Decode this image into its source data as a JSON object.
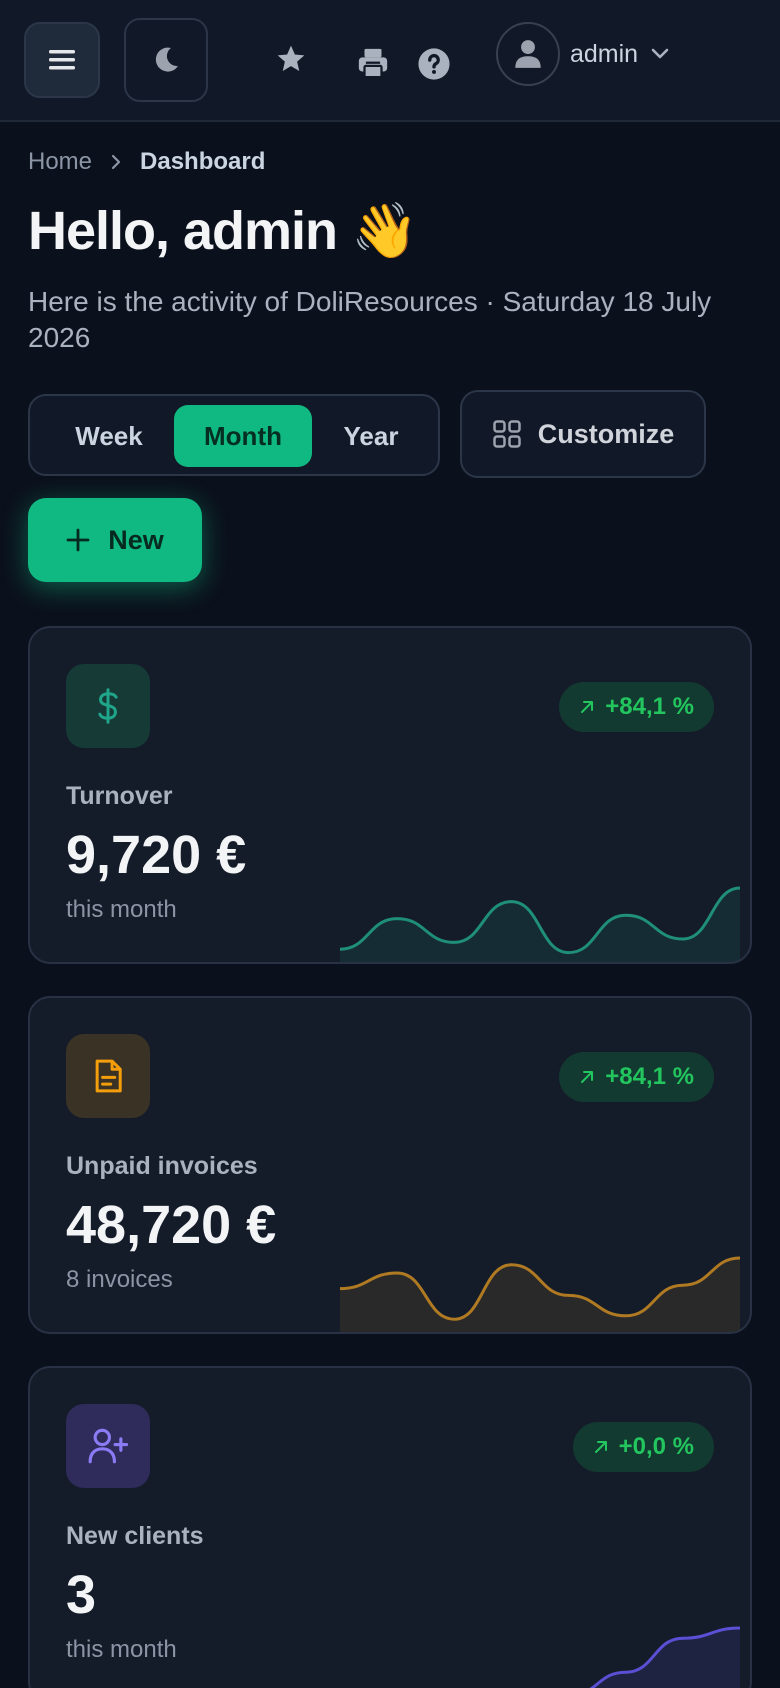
{
  "topbar": {
    "user_name": "admin",
    "icons": [
      "menu-icon",
      "moon-icon",
      "star-icon",
      "printer-icon",
      "help-icon",
      "user-icon",
      "chevron-down-icon"
    ]
  },
  "breadcrumb": {
    "home": "Home",
    "current": "Dashboard"
  },
  "header": {
    "title": "Hello, admin",
    "emoji": "👋",
    "subtitle": "Here is the activity of DoliResources · Saturday 18 July 2026"
  },
  "period": {
    "options": [
      "Week",
      "Month",
      "Year"
    ],
    "selected": "Month"
  },
  "actions": {
    "customize_label": "Customize",
    "new_label": "New"
  },
  "colors": {
    "accent": "#10b981",
    "positive": "#22c55e",
    "amber": "#f59e0b",
    "violet": "#8b5cf6"
  },
  "cards": [
    {
      "label": "Turnover",
      "value": "9,720 €",
      "note": "this month",
      "trend": "+84,1 %",
      "icon": "dollar-icon",
      "color": "#1f8f7a",
      "spark": [
        0.1,
        0.55,
        0.2,
        0.8,
        0.05,
        0.6,
        0.25,
        1.0
      ]
    },
    {
      "label": "Unpaid invoices",
      "value": "48,720 €",
      "note": "8 invoices",
      "trend": "+84,1 %",
      "icon": "document-icon",
      "color": "#b07a23",
      "spark": [
        0.55,
        0.78,
        0.1,
        0.9,
        0.45,
        0.15,
        0.6,
        1.0
      ]
    },
    {
      "label": "New clients",
      "value": "3",
      "note": "this month",
      "trend": "+0,0 %",
      "icon": "user-plus-icon",
      "color": "#5b4fd6",
      "spark": [
        0.0,
        0.0,
        0.0,
        0.0,
        0.0,
        0.35,
        0.85,
        1.0
      ]
    }
  ]
}
